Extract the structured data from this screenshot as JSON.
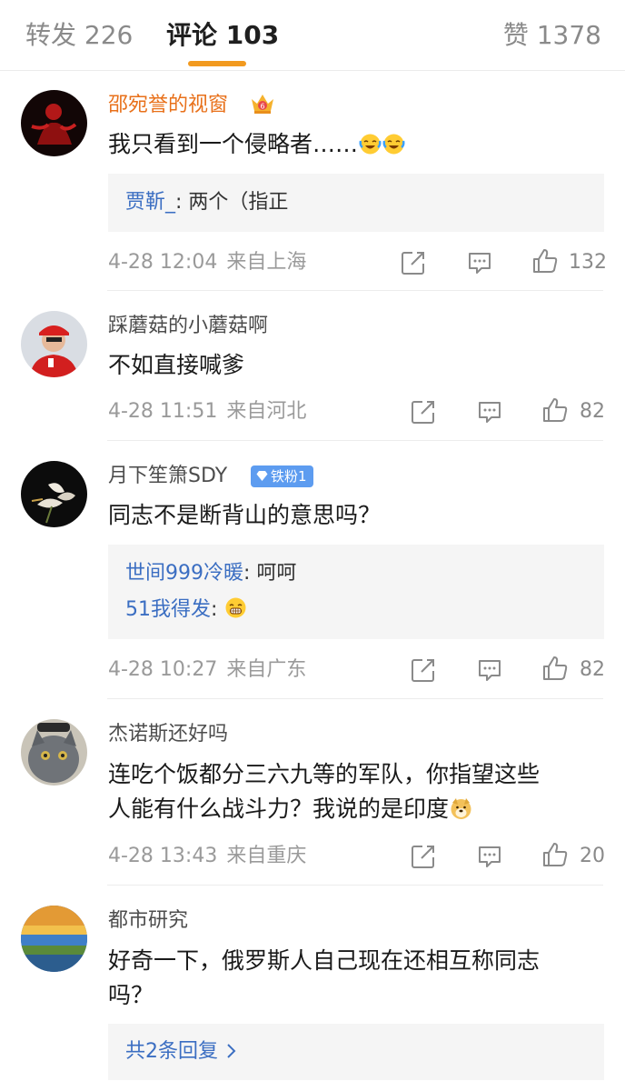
{
  "tabs": {
    "repost": "转发 226",
    "comments": "评论 103",
    "likes": "赞 1378"
  },
  "comments": [
    {
      "user": "邵宛誉的视窗",
      "text": "我只看到一个侵略者……",
      "emojis": [
        "laugh-cry-emoji",
        "laugh-cry-emoji"
      ],
      "replies": [
        {
          "name": "贾靳_",
          "text": ": 两个（指正"
        }
      ],
      "time": "4-28 12:04",
      "location": "来自上海",
      "likes": "132"
    },
    {
      "user": "踩蘑菇的小蘑菇啊",
      "text": "不如直接喊爹",
      "time": "4-28 11:51",
      "location": "来自河北",
      "likes": "82"
    },
    {
      "user": "月下笙箫SDY",
      "badge": "铁粉1",
      "text": "同志不是断背山的意思吗？",
      "replies": [
        {
          "name": "世间999冷暖",
          "text": ": 呵呵"
        },
        {
          "name": "51我得发",
          "text": ": "
        }
      ],
      "time": "4-28 10:27",
      "location": "来自广东",
      "likes": "82"
    },
    {
      "user": "杰诺斯还好吗",
      "text_line1": "连吃个饭都分三六九等的军队，你指望这些",
      "text_line2": "人能有什么战斗力？我说的是印度",
      "time": "4-28 13:43",
      "location": "来自重庆",
      "likes": "20"
    },
    {
      "user": "都市研究",
      "text_line1": "好奇一下，俄罗斯人自己现在还相互称同志",
      "text_line2": "吗？",
      "more_replies": "共2条回复"
    }
  ],
  "colors": {
    "accent": "#f29a1f",
    "vip_name": "#e8701a",
    "link": "#3b6ec2",
    "badge": "#5d9cf0"
  }
}
